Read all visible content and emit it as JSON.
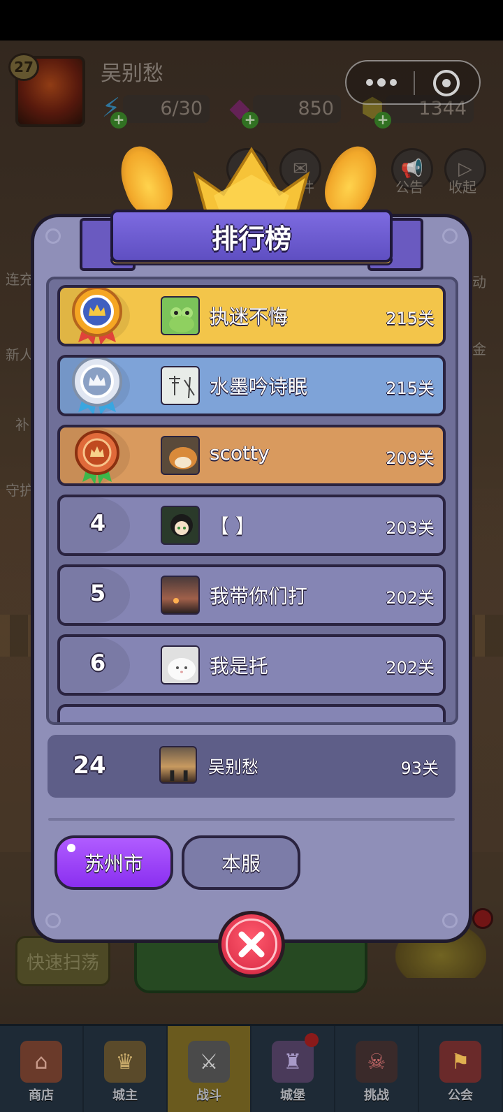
{
  "player": {
    "level": "27",
    "name": "吴别愁",
    "energy": "6/30",
    "gems": "850",
    "coins": "1344"
  },
  "top_icons": {
    "mail_label": "件",
    "notice_label": "公告",
    "collapse_label": "收起"
  },
  "side_labels": {
    "left": [
      "连充",
      "新人",
      "补",
      "守护"
    ],
    "right": [
      "动",
      "金"
    ]
  },
  "leaderboard": {
    "title": "排行榜",
    "entries": [
      {
        "rank": "1",
        "name": "执迷不悔",
        "score": "215关",
        "tier": "gold"
      },
      {
        "rank": "2",
        "name": "水墨吟诗眠",
        "score": "215关",
        "tier": "silver"
      },
      {
        "rank": "3",
        "name": "scotty",
        "score": "209关",
        "tier": "bronze"
      },
      {
        "rank": "4",
        "name": "【 】",
        "score": "203关",
        "tier": "normal"
      },
      {
        "rank": "5",
        "name": "我带你们打",
        "score": "202关",
        "tier": "normal"
      },
      {
        "rank": "6",
        "name": "我是托",
        "score": "202关",
        "tier": "normal"
      }
    ],
    "my_entry": {
      "rank": "24",
      "name": "吴别愁",
      "score": "93关"
    },
    "tabs": {
      "active": "苏州市",
      "inactive": "本服"
    }
  },
  "behind": {
    "sweep_label": "快速扫荡"
  },
  "bottom_nav": [
    {
      "label": "商店",
      "active": false
    },
    {
      "label": "城主",
      "active": false
    },
    {
      "label": "战斗",
      "active": true
    },
    {
      "label": "城堡",
      "active": false
    },
    {
      "label": "挑战",
      "active": false
    },
    {
      "label": "公会",
      "active": false
    }
  ],
  "colors": {
    "gold_row": "#f3c54a",
    "silver_row": "#7ea3d8",
    "bronze_row": "#d99a5e",
    "normal_row": "#8585b4",
    "panel": "#8f8fb8",
    "ribbon": "#6c5ad4",
    "tab_active": "#9a3ff5",
    "close": "#e0334c"
  }
}
